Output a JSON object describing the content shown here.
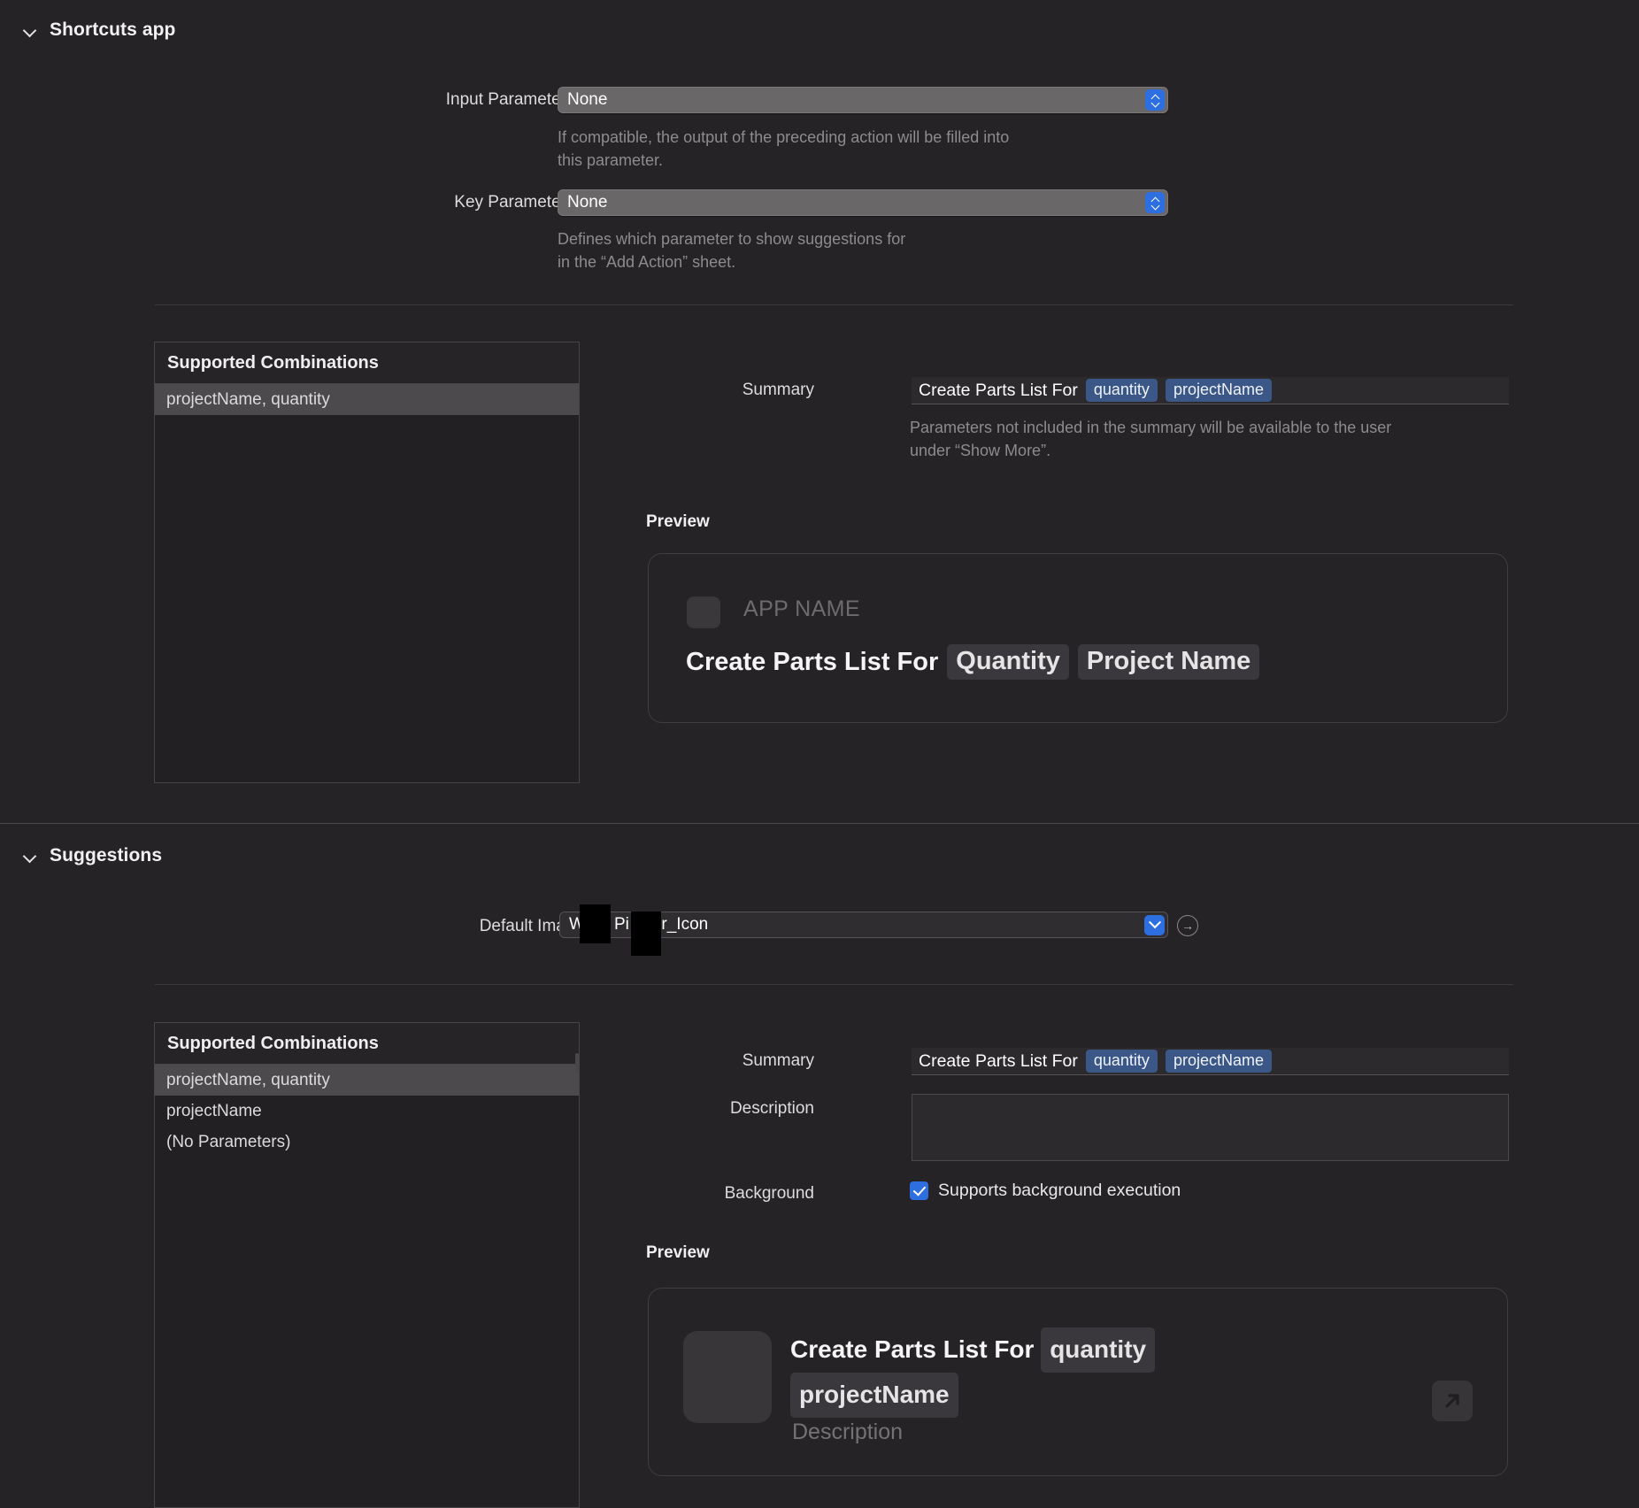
{
  "sections": [
    {
      "id": "shortcuts-app",
      "title": "Shortcuts app",
      "disclosure_icon": "chevron-down-icon",
      "input_parameter": {
        "label": "Input Parameter",
        "value": "None",
        "help": "If compatible, the output of the preceding action will be filled into\nthis parameter."
      },
      "key_parameter": {
        "label": "Key Parameter",
        "value": "None",
        "help": "Defines which parameter to show suggestions for\nin the “Add Action” sheet."
      },
      "combinations": {
        "header": "Supported Combinations",
        "rows": [
          {
            "label": "projectName, quantity",
            "selected": true
          }
        ]
      },
      "summary": {
        "label": "Summary",
        "prefix": "Create Parts List For",
        "tokens": [
          "quantity",
          "projectName"
        ],
        "help": "Parameters not included in the summary will be available to the user\nunder “Show More”."
      },
      "preview": {
        "label": "Preview",
        "app_name": "APP NAME",
        "headline_prefix": "Create Parts List For",
        "chips": [
          "Quantity",
          "Project Name"
        ]
      }
    },
    {
      "id": "suggestions",
      "title": "Suggestions",
      "disclosure_icon": "chevron-down-icon",
      "default_image": {
        "label": "Default Image",
        "value_before": "W",
        "value_middle": "Pi",
        "value_after": "er_Icon",
        "reveal_icon": "circle-arrow-right-icon"
      },
      "combinations": {
        "header": "Supported Combinations",
        "rows": [
          {
            "label": "projectName, quantity",
            "selected": true
          },
          {
            "label": "projectName",
            "selected": false
          },
          {
            "label": "(No Parameters)",
            "selected": false
          }
        ]
      },
      "summary": {
        "label": "Summary",
        "prefix": "Create Parts List For",
        "tokens": [
          "quantity",
          "projectName"
        ]
      },
      "description": {
        "label": "Description",
        "value": ""
      },
      "background": {
        "label": "Background",
        "checkbox_label": "Supports background execution",
        "checked": true
      },
      "preview": {
        "label": "Preview",
        "headline_prefix": "Create Parts List For",
        "chip_quantity": "quantity",
        "chip_project": "projectName",
        "description_placeholder": "Description",
        "open_icon": "arrow-up-right-icon"
      }
    }
  ],
  "colors": {
    "window_background": "#252326",
    "accent_blue": "#2d6fe0",
    "token_blue": "#3a5787",
    "selected_row": "#4c4a4d",
    "muted_text": "#8e8b8d"
  }
}
